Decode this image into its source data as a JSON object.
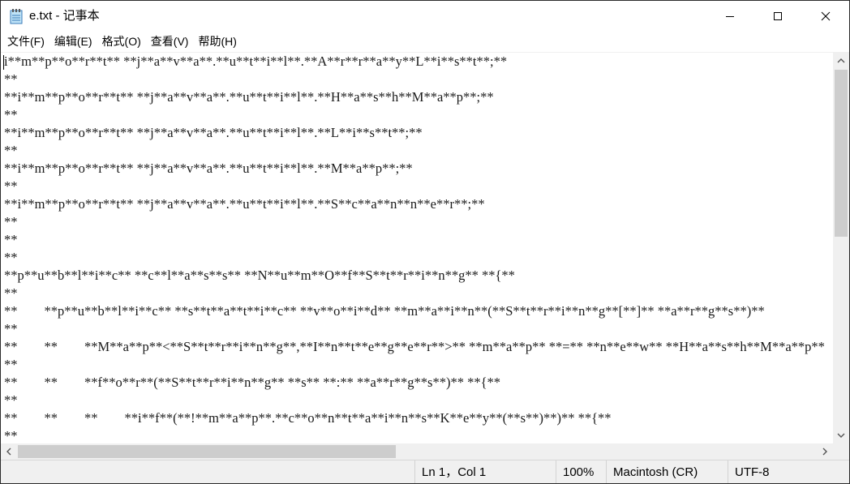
{
  "window": {
    "title": "e.txt - 记事本",
    "icon": "notepad-icon",
    "controls": [
      "minimize-icon",
      "maximize-icon",
      "close-icon"
    ]
  },
  "menu": [
    {
      "label": "文件(F)"
    },
    {
      "label": "编辑(E)"
    },
    {
      "label": "格式(O)"
    },
    {
      "label": "查看(V)"
    },
    {
      "label": "帮助(H)"
    }
  ],
  "editor": {
    "lines": [
      "i**m**p**o**r**t** **j**a**v**a**.**u**t**i**l**.**A**r**r**a**y**L**i**s**t**;**",
      "**",
      "**i**m**p**o**r**t** **j**a**v**a**.**u**t**i**l**.**H**a**s**h**M**a**p**;**",
      "**",
      "**i**m**p**o**r**t** **j**a**v**a**.**u**t**i**l**.**L**i**s**t**;**",
      "**",
      "**i**m**p**o**r**t** **j**a**v**a**.**u**t**i**l**.**M**a**p**;**",
      "**",
      "**i**m**p**o**r**t** **j**a**v**a**.**u**t**i**l**.**S**c**a**n**n**e**r**;**",
      "**",
      "**",
      "**",
      "**p**u**b**l**i**c** **c**l**a**s**s** **N**u**m**O**f**S**t**r**i**n**g** **{**",
      "**",
      "**\t\t**p**u**b**l**i**c** **s**t**a**t**i**c** **v**o**i**d** **m**a**i**n**(**S**t**r**i**n**g**[**]** **a**r**g**s**)**",
      "**",
      "**\t\t**\t\t**M**a**p**<**S**t**r**i**n**g**,**I**n**t**e**g**e**r**>** **m**a**p** **=** **n**e**w** **H**a**s**h**M**a**p**",
      "**",
      "**\t\t**\t\t**f**o**r**(**S**t**r**i**n**g** **s** **:** **a**r**g**s**)** **{**",
      "**",
      "**\t\t**\t\t**\t\t**i**f**(**!**m**a**p**.**c**o**n**t**a**i**n**s**K**e**y**(**s**)**)** **{**",
      "**"
    ]
  },
  "status": {
    "position": "Ln 1，Col 1",
    "zoom": "100%",
    "line_ending": "Macintosh (CR)",
    "encoding": "UTF-8"
  }
}
